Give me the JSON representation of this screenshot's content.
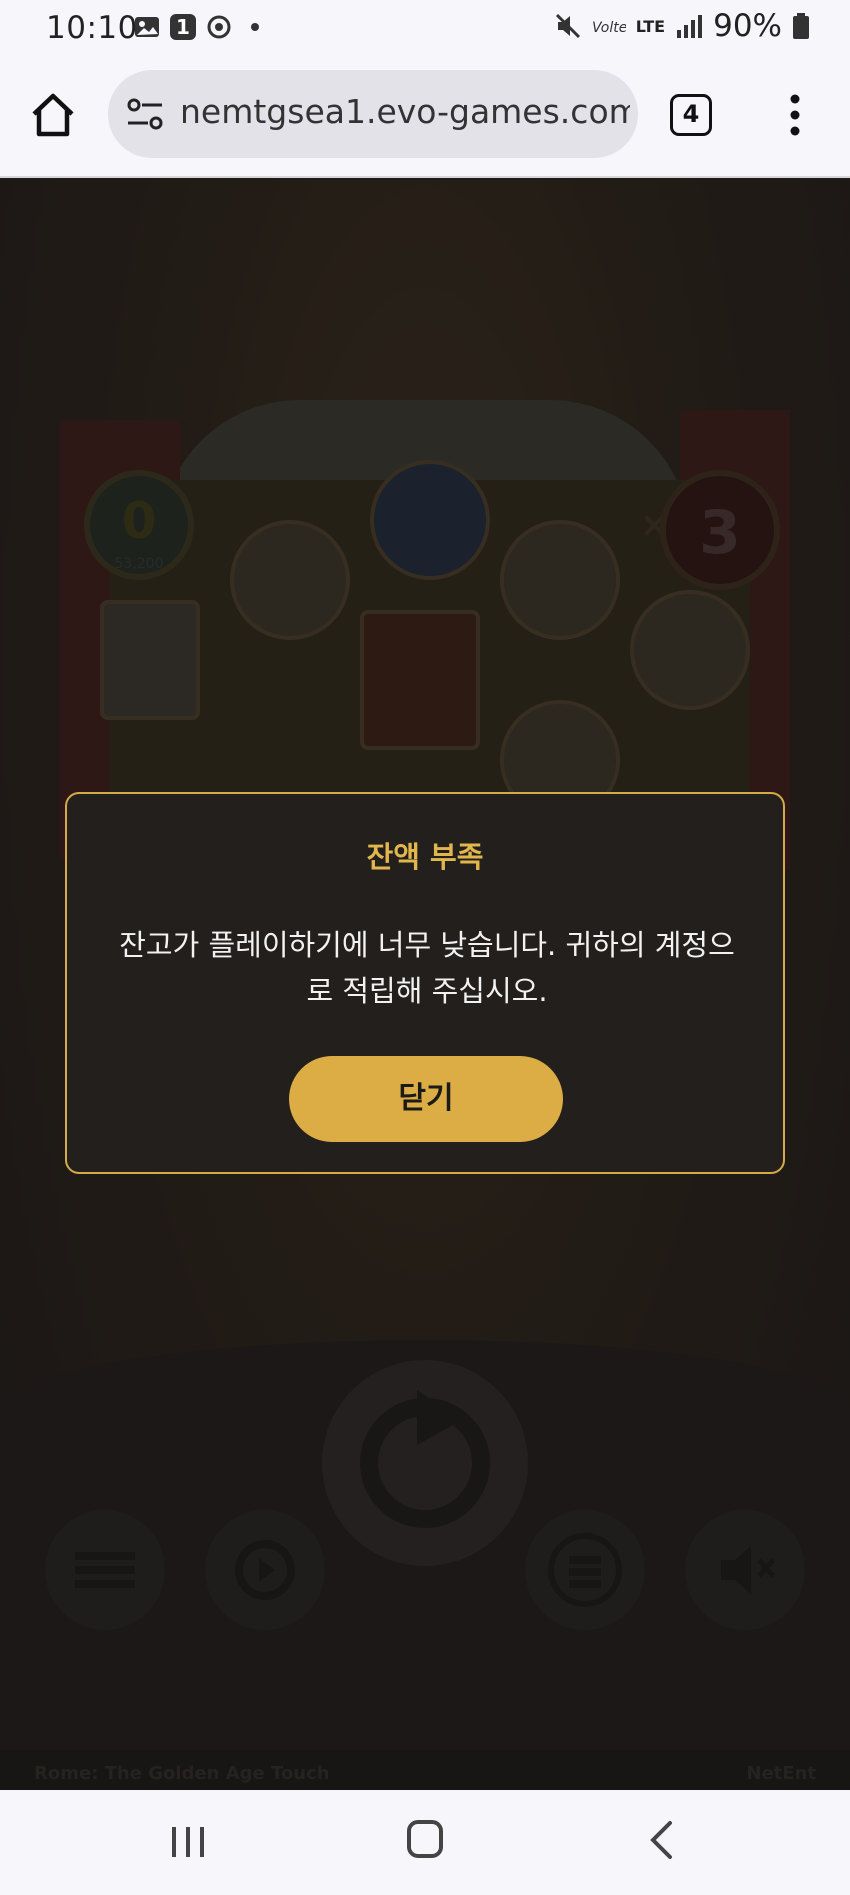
{
  "status_bar": {
    "time": "10:10",
    "notification_count": "1",
    "battery": "90%",
    "network": "LTE"
  },
  "browser": {
    "url": "nemtgsea1.evo-games.com",
    "tab_count": "4"
  },
  "dialog": {
    "title": "잔액 부족",
    "message": "잔고가 플레이하기에 너무 낮습니다. 귀하의 계정으로 적립해 주십시오.",
    "close_label": "닫기"
  },
  "game": {
    "free_spins_counter": "0",
    "counter_sub": "53,200",
    "multiplier": "3",
    "multiplier_prefix": "×",
    "footer_title": "Rome: The Golden Age Touch",
    "footer_brand": "NetEnt"
  },
  "colors": {
    "accent": "#dcad44",
    "dialog_border": "#d4ab47",
    "dialog_title": "#e1b64d",
    "dialog_bg": "#221f1c"
  }
}
